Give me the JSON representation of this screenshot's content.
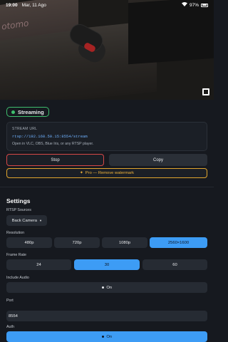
{
  "status_bar": {
    "time": "19:00",
    "date": "Mar, 11 Ago",
    "battery": "97%",
    "battery_level": 0.97
  },
  "preview": {
    "box_text": "otomo"
  },
  "stream": {
    "status": "Streaming",
    "status_color": "#3fbf6e",
    "url_label": "STREAM URL",
    "url": "rtsp://192.168.50.15:8554/stream",
    "hint": "Open in VLC, OBS, Blue Iris, or any RTSP player."
  },
  "actions": {
    "stop_label": "Stop",
    "copy_label": "Copy",
    "pro_label": "Pro — Remove watermark",
    "pro_icon": "✦"
  },
  "settings": {
    "title": "Settings",
    "rtsp_sources": {
      "label": "RTSP Sources",
      "selected": "Back Camera"
    },
    "resolution": {
      "label": "Resolution",
      "options": [
        "480p",
        "720p",
        "1080p",
        "2560×1600"
      ],
      "selected_index": 3
    },
    "frame_rate": {
      "label": "Frame Rate",
      "options": [
        "24",
        "30",
        "60"
      ],
      "selected_index": 1
    },
    "include_audio": {
      "label": "Include Audio",
      "value": "On"
    },
    "port": {
      "label": "Port",
      "value": "8554"
    },
    "auth": {
      "label": "Auth",
      "value": "On"
    }
  },
  "colors": {
    "accent": "#3d9cf5",
    "danger": "#d64848",
    "pro": "#f0b33a",
    "background": "#16191f"
  }
}
